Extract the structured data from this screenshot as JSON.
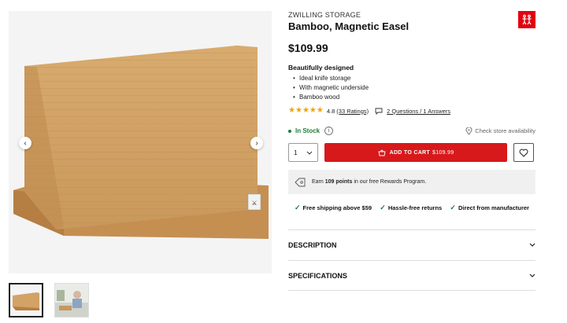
{
  "product": {
    "brand": "ZWILLING STORAGE",
    "title": "Bamboo, Magnetic Easel",
    "price": "$109.99",
    "features_title": "Beautifully designed",
    "features": [
      "Ideal knife storage",
      "With magnetic underside",
      "Bamboo wood"
    ]
  },
  "rating": {
    "stars": 4.8,
    "value_text": "4.8",
    "count_text": "(33 Ratings)",
    "qa_text": "2 Questions / 1 Answers"
  },
  "stock": {
    "status": "In Stock",
    "store_text": "Check store availability"
  },
  "cart": {
    "qty": "1",
    "add_label": "ADD TO CART",
    "add_price": "$109.99"
  },
  "rewards": {
    "prefix": "Earn",
    "points": "109 points",
    "suffix": "in our free Rewards Program."
  },
  "benefits": [
    "Free shipping above $59",
    "Hassle-free returns",
    "Direct from manufacturer"
  ],
  "accordion": [
    {
      "label": "DESCRIPTION"
    },
    {
      "label": "SPECIFICATIONS"
    }
  ],
  "colors": {
    "brand_red": "#e3000f",
    "cart_red": "#d7191b",
    "stock_green": "#1a7f37",
    "star": "#f0a500"
  }
}
